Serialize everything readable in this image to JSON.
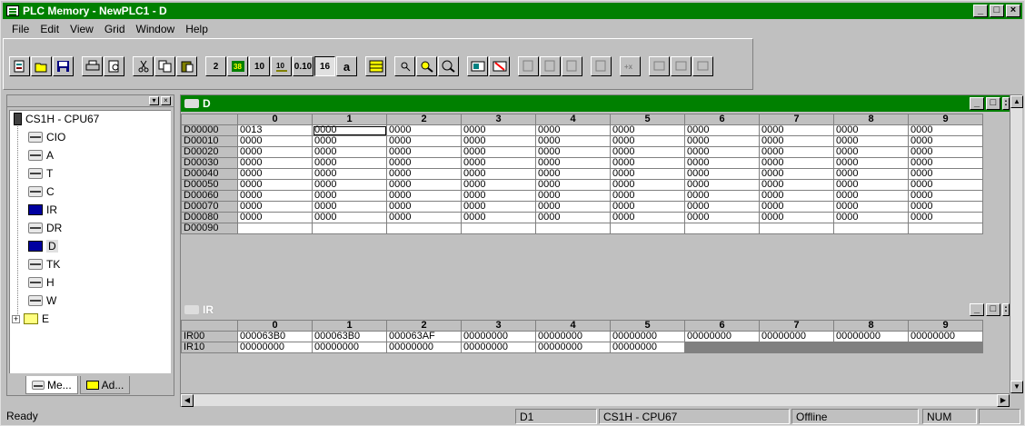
{
  "window": {
    "title": "PLC Memory - NewPLC1 - D"
  },
  "menu": {
    "file": "File",
    "edit": "Edit",
    "view": "View",
    "grid": "Grid",
    "window": "Window",
    "help": "Help"
  },
  "toolbar": {
    "buttons": [
      "new-icon",
      "open-icon",
      "save-icon",
      "print-icon",
      "print-preview-icon",
      "cut-icon",
      "copy-icon",
      "paste-icon",
      "binary-icon",
      "bcd-icon",
      "decimal-icon",
      "signed-decimal-icon",
      "float-icon",
      "hex-icon",
      "ascii-icon",
      "table-icon",
      "find-icon",
      "find-next-icon",
      "zoom-icon",
      "transfer-to-plc-icon",
      "transfer-from-plc-icon",
      "compare-icon",
      "set-icon",
      "reset-icon",
      "force-on-icon",
      "clear-force-icon",
      "monitor-icon",
      "online-edit-icon",
      "watch-icon"
    ],
    "labels": {
      "hex": "16",
      "ascii": "a",
      "dec": "10",
      "float": "0.10",
      "bin": "2"
    }
  },
  "tree": {
    "root": "CS1H - CPU67",
    "items": [
      "CIO",
      "A",
      "T",
      "C",
      "IR",
      "DR",
      "D",
      "TK",
      "H",
      "W",
      "E"
    ],
    "tabs": [
      "Me...",
      "Ad..."
    ]
  },
  "d_window": {
    "title": "D",
    "columns": [
      "0",
      "1",
      "2",
      "3",
      "4",
      "5",
      "6",
      "7",
      "8",
      "9"
    ],
    "rows": [
      {
        "addr": "D00000",
        "values": [
          "0013",
          "0000",
          "0000",
          "0000",
          "0000",
          "0000",
          "0000",
          "0000",
          "0000",
          "0000"
        ]
      },
      {
        "addr": "D00010",
        "values": [
          "0000",
          "0000",
          "0000",
          "0000",
          "0000",
          "0000",
          "0000",
          "0000",
          "0000",
          "0000"
        ]
      },
      {
        "addr": "D00020",
        "values": [
          "0000",
          "0000",
          "0000",
          "0000",
          "0000",
          "0000",
          "0000",
          "0000",
          "0000",
          "0000"
        ]
      },
      {
        "addr": "D00030",
        "values": [
          "0000",
          "0000",
          "0000",
          "0000",
          "0000",
          "0000",
          "0000",
          "0000",
          "0000",
          "0000"
        ]
      },
      {
        "addr": "D00040",
        "values": [
          "0000",
          "0000",
          "0000",
          "0000",
          "0000",
          "0000",
          "0000",
          "0000",
          "0000",
          "0000"
        ]
      },
      {
        "addr": "D00050",
        "values": [
          "0000",
          "0000",
          "0000",
          "0000",
          "0000",
          "0000",
          "0000",
          "0000",
          "0000",
          "0000"
        ]
      },
      {
        "addr": "D00060",
        "values": [
          "0000",
          "0000",
          "0000",
          "0000",
          "0000",
          "0000",
          "0000",
          "0000",
          "0000",
          "0000"
        ]
      },
      {
        "addr": "D00070",
        "values": [
          "0000",
          "0000",
          "0000",
          "0000",
          "0000",
          "0000",
          "0000",
          "0000",
          "0000",
          "0000"
        ]
      },
      {
        "addr": "D00080",
        "values": [
          "0000",
          "0000",
          "0000",
          "0000",
          "0000",
          "0000",
          "0000",
          "0000",
          "0000",
          "0000"
        ]
      },
      {
        "addr": "D00090",
        "values": [
          "",
          "",
          "",
          "",
          "",
          "",
          "",
          "",
          "",
          ""
        ]
      }
    ]
  },
  "ir_window": {
    "title": "IR",
    "columns": [
      "0",
      "1",
      "2",
      "3",
      "4",
      "5",
      "6",
      "7",
      "8",
      "9"
    ],
    "rows": [
      {
        "addr": "IR00",
        "values": [
          "000063B0",
          "000063B0",
          "000063AF",
          "00000000",
          "00000000",
          "00000000",
          "00000000",
          "00000000",
          "00000000",
          "00000000"
        ]
      },
      {
        "addr": "IR10",
        "values": [
          "00000000",
          "00000000",
          "00000000",
          "00000000",
          "00000000",
          "00000000"
        ]
      }
    ]
  },
  "status": {
    "ready": "Ready",
    "address": "D1",
    "device": "CS1H - CPU67",
    "mode": "Offline",
    "num": "NUM"
  }
}
